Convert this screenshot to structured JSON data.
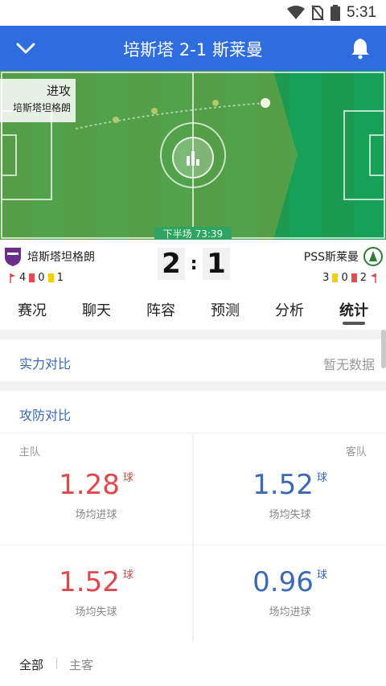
{
  "status": {
    "time": "5:31"
  },
  "header": {
    "title": "培斯塔 2-1 斯莱曼"
  },
  "pitch": {
    "attack_label": "进攻",
    "attack_team": "培斯塔坦格朗",
    "match_time": "下半场 73:39",
    "colors": {
      "pitch": "#16a058",
      "attack_zone": "#8a9a3a"
    }
  },
  "match": {
    "home": {
      "name": "培斯塔坦格朗",
      "corners": "4",
      "red_cards": "0",
      "yellow_cards": "1"
    },
    "away": {
      "name": "PSS斯莱曼",
      "yellow_cards": "3",
      "red_cards": "0",
      "corners": "2"
    },
    "score": {
      "home": "2",
      "away": "1"
    }
  },
  "tabs": [
    "赛况",
    "聊天",
    "阵容",
    "预测",
    "分析",
    "统计"
  ],
  "strength": {
    "title": "实力对比",
    "note": "暂无数据"
  },
  "attack_defense": {
    "title": "攻防对比",
    "home_label": "主队",
    "away_label": "客队",
    "unit": "球",
    "home_goals_avg": "1.28",
    "home_goals_label": "场均进球",
    "away_conceded_avg": "1.52",
    "away_conceded_label": "场均失球",
    "home_conceded_avg": "1.52",
    "home_conceded_label": "场均失球",
    "away_goals_avg": "0.96",
    "away_goals_label": "场均进球"
  },
  "filter": {
    "all": "全部",
    "home_away": "主客"
  }
}
